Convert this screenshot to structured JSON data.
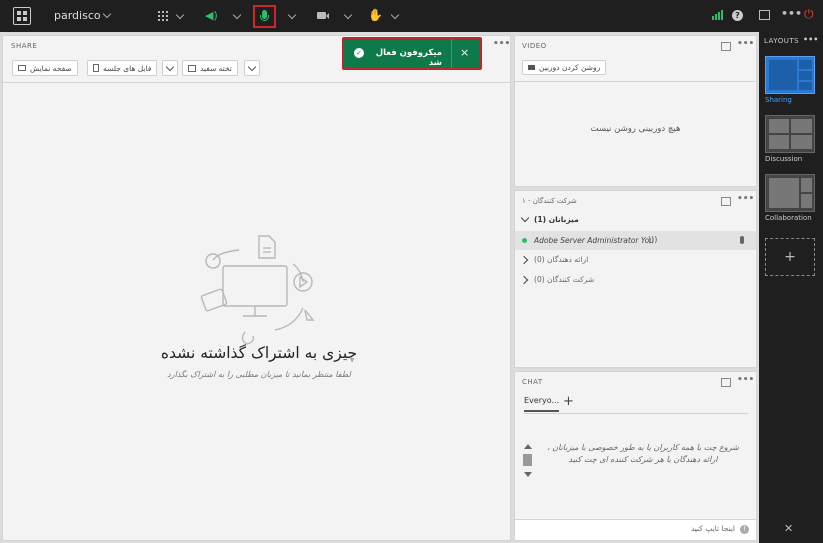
{
  "app": {
    "title": "pardisco"
  },
  "toolbar": {
    "icons": [
      "apps-icon",
      "speaker-icon",
      "microphone-icon",
      "camera-icon",
      "raise-hand-icon"
    ],
    "right_icons": [
      "signal-icon",
      "help-icon",
      "fullscreen-icon",
      "more-icon",
      "power-icon"
    ]
  },
  "toast": {
    "message": "میکروفون فعال شد",
    "close": "×"
  },
  "share": {
    "title": "SHARE",
    "buttons": [
      "صفحه نمایش",
      "فایل های جلسه",
      "تخته سفید"
    ],
    "empty_title": "چیزی به اشتراک گذاشته نشده",
    "empty_subtitle": "لطفا منتظر بمانید تا میزبان مطلبی را به اشتراک بگذارد"
  },
  "video": {
    "title": "VIDEO",
    "camera_button": "روشن کردن دوربین",
    "empty_text": "هیچ دوربینی روشن نیست"
  },
  "attendees": {
    "title": "شرکت کنندگان - ۱",
    "hosts_label": "میزبانان (1)",
    "host_name": "Adobe Server Administrator You",
    "presenters_label": "ارائه دهندگان (0)",
    "participants_label": "شرکت کنندگان (0)"
  },
  "chat": {
    "title": "CHAT",
    "tab_label": "Everyo...",
    "add_tab": "+",
    "empty_text": "شروع چت با همه کاربران یا به طور خصوصی با میزبانان ، ارائه دهندگان یا هر شرکت کننده ای چت کنید",
    "input_placeholder": "اینجا تایپ کنید"
  },
  "layouts": {
    "title": "LAYOUTS",
    "items": [
      "Sharing",
      "Discussion",
      "Collaboration"
    ],
    "add": "+"
  },
  "colors": {
    "accent_blue": "#2a79d4",
    "toast_green": "#0e7a4a",
    "mic_green": "#2ebd6b",
    "highlight_red": "#c0262b"
  }
}
